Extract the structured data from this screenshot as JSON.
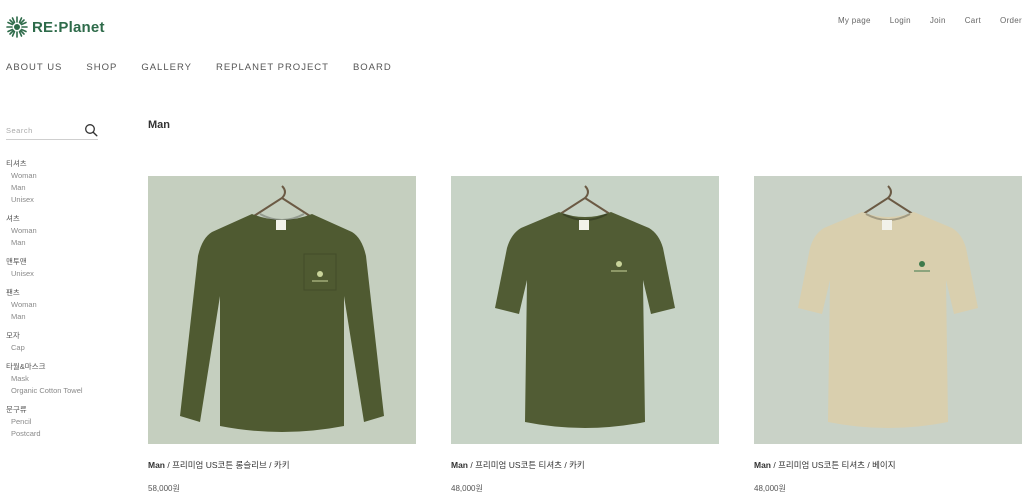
{
  "brand": {
    "name": "RE:Planet",
    "color": "#2e6b4a"
  },
  "top_nav": [
    "My page",
    "Login",
    "Join",
    "Cart",
    "Order"
  ],
  "main_nav": [
    "ABOUT US",
    "SHOP",
    "GALLERY",
    "REPLANET PROJECT",
    "BOARD"
  ],
  "search": {
    "placeholder": "Search",
    "icon": "search-icon"
  },
  "categories": [
    {
      "title": "티셔츠",
      "items": [
        "Woman",
        "Man",
        "Unisex"
      ]
    },
    {
      "title": "셔츠",
      "items": [
        "Woman",
        "Man"
      ]
    },
    {
      "title": "맨투맨",
      "items": [
        "Unisex"
      ]
    },
    {
      "title": "팬츠",
      "items": [
        "Woman",
        "Man"
      ]
    },
    {
      "title": "모자",
      "items": [
        "Cap"
      ]
    },
    {
      "title": "타월&마스크",
      "items": [
        "Mask",
        "Organic Cotton Towel"
      ]
    },
    {
      "title": "문구류",
      "items": [
        "Pencil",
        "Postcard"
      ]
    }
  ],
  "page_title": "Man",
  "products": [
    {
      "name": "Man / 프리미엄 US코튼 롱슬리브 / 카키",
      "price": "58,000원",
      "shirt_color": "#4f5a31",
      "bg_color": "#c5cfbf",
      "sleeve": "long"
    },
    {
      "name": "Man / 프리미엄 US코튼 티셔츠 / 카키",
      "price": "48,000원",
      "shirt_color": "#515c34",
      "bg_color": "#c7d3c6",
      "sleeve": "short"
    },
    {
      "name": "Man / 프리미엄 US코튼 티셔츠 / 베이지",
      "price": "48,000원",
      "shirt_color": "#d9cfae",
      "bg_color": "#c9d2c7",
      "sleeve": "short"
    }
  ]
}
